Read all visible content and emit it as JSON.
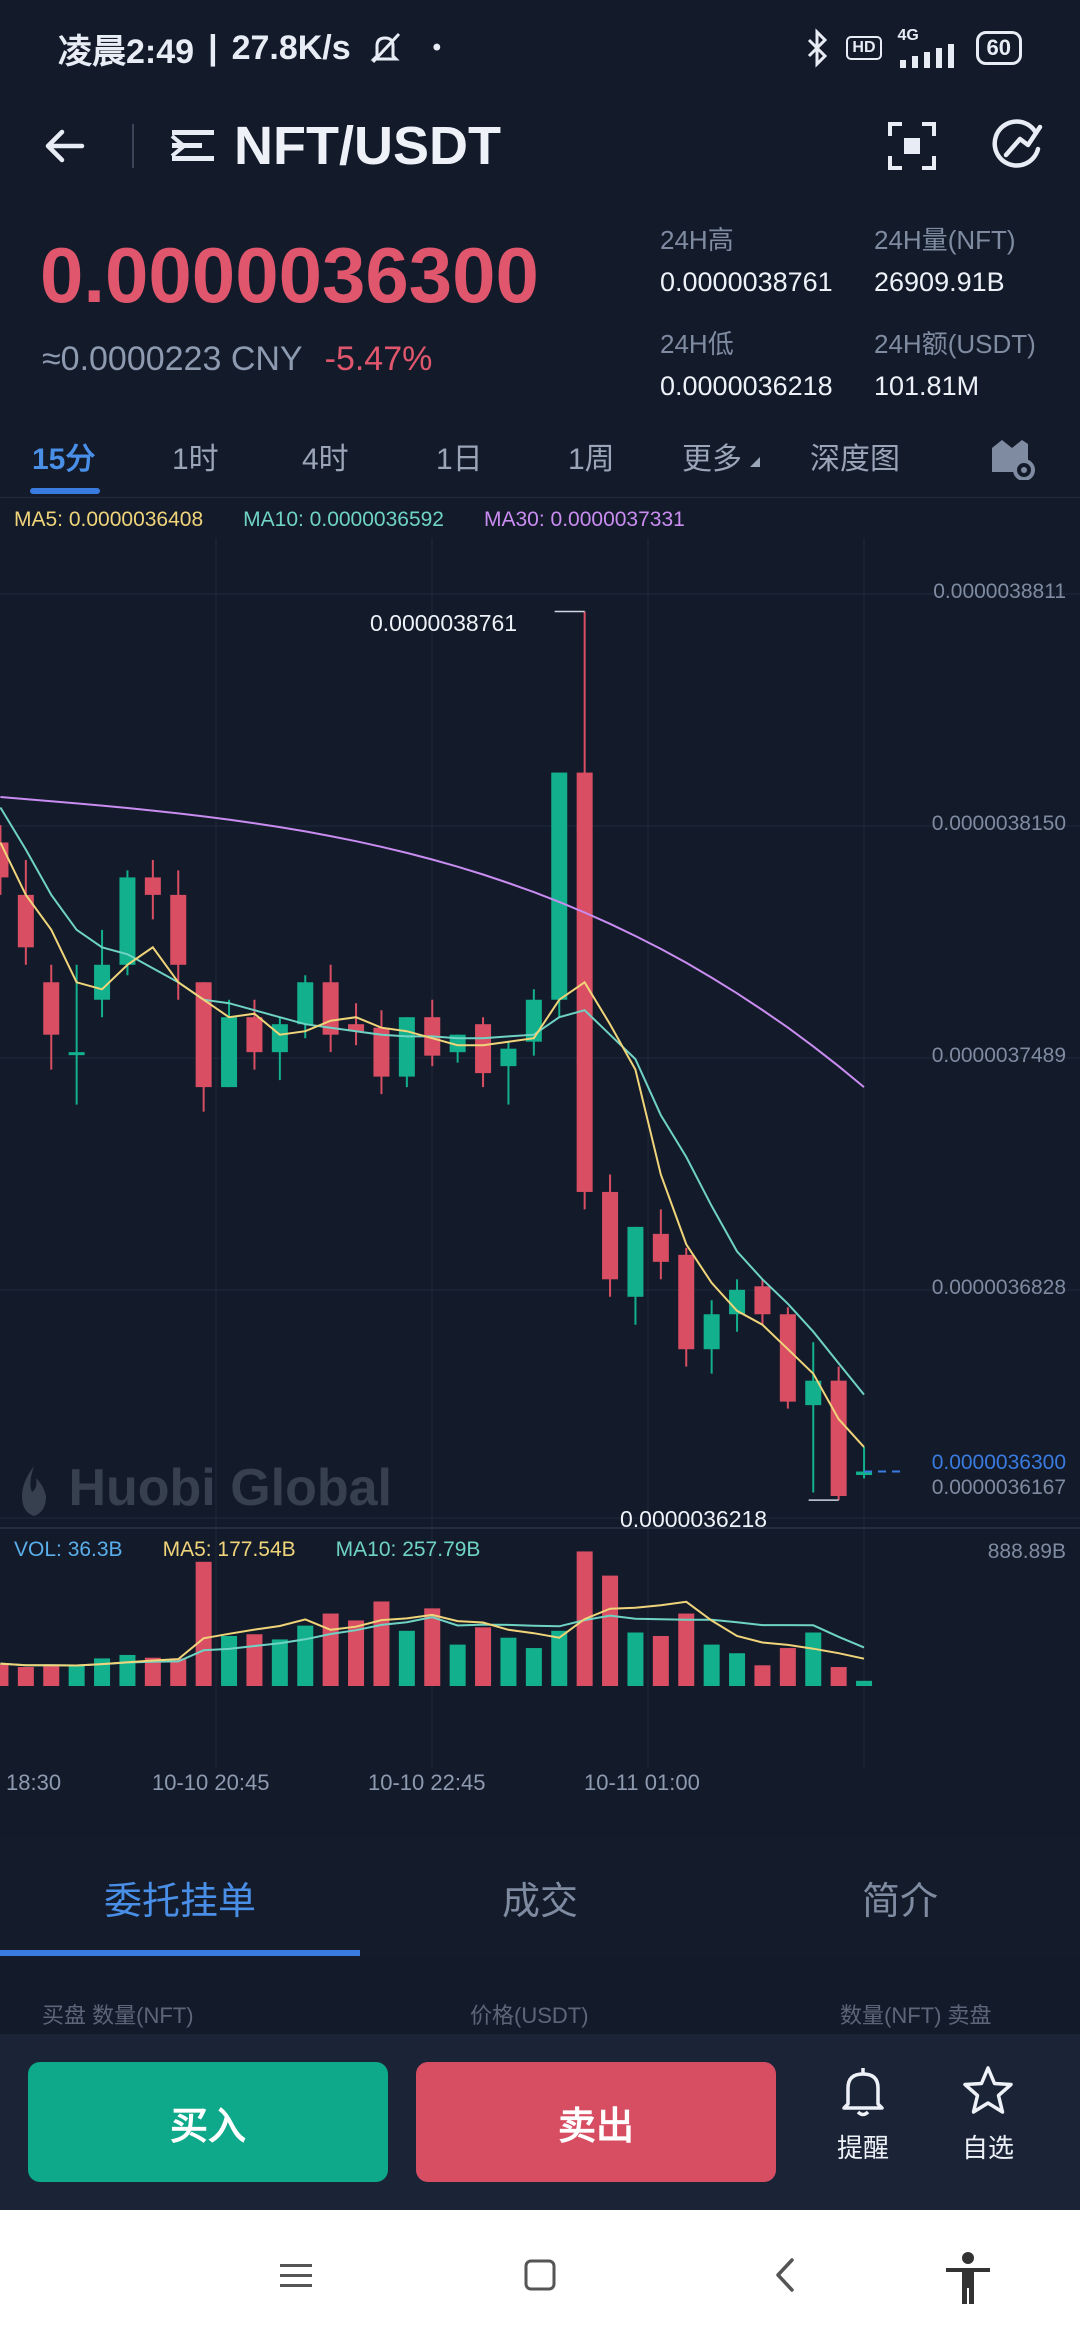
{
  "status_bar": {
    "time": "凌晨2:49",
    "speed": "27.8K/s",
    "dot": "•",
    "hd": "HD",
    "network": "4G",
    "battery": "60"
  },
  "header": {
    "pair": "NFT/USDT"
  },
  "ticker": {
    "price": "0.0000036300",
    "cny": "≈0.0000223 CNY",
    "change": "-5.47%",
    "high_label": "24H高",
    "high_value": "0.0000038761",
    "vol_label": "24H量(NFT)",
    "vol_value": "26909.91B",
    "low_label": "24H低",
    "low_value": "0.0000036218",
    "amount_label": "24H额(USDT)",
    "amount_value": "101.81M"
  },
  "timeframe_tabs": [
    {
      "label": "15分",
      "active": true
    },
    {
      "label": "1时"
    },
    {
      "label": "4时"
    },
    {
      "label": "1日"
    },
    {
      "label": "1周"
    },
    {
      "label": "更多"
    },
    {
      "label": "深度图"
    }
  ],
  "ma_legend": {
    "ma5": "MA5: 0.0000036408",
    "ma10": "MA10: 0.0000036592",
    "ma30": "MA30: 0.0000037331"
  },
  "vol_legend": {
    "vol": "VOL: 36.3B",
    "ma5": "MA5: 177.54B",
    "ma10": "MA10: 257.79B"
  },
  "watermark": "Huobi Global",
  "colors": {
    "up": "#12b08c",
    "down": "#d94e63",
    "ma5": "#f0d47a",
    "ma10": "#6fd3c4",
    "ma30": "#c98cf0",
    "accent": "#3a7be0"
  },
  "chart_data": {
    "type": "candlestick",
    "y_axis_ticks": [
      "0.0000038811",
      "0.0000038150",
      "0.0000037489",
      "0.0000036828",
      "0.0000036167"
    ],
    "y_range": [
      3.6167e-06,
      3.8811e-06
    ],
    "current_price_label": "0.0000036300",
    "high_marker": "0.0000038761",
    "low_marker": "0.0000036218",
    "volume_axis_max": "888.89B",
    "x_labels": [
      "18:30",
      "10-10 20:45",
      "10-10 22:45",
      "10-11 01:00"
    ],
    "candles": [
      {
        "o": 3.81,
        "h": 3.815,
        "c": 3.8,
        "l": 3.795
      },
      {
        "o": 3.795,
        "h": 3.805,
        "c": 3.78,
        "l": 3.775
      },
      {
        "o": 3.77,
        "h": 3.775,
        "c": 3.755,
        "l": 3.745
      },
      {
        "o": 3.75,
        "h": 3.775,
        "c": 3.75,
        "l": 3.735
      },
      {
        "o": 3.765,
        "h": 3.785,
        "c": 3.775,
        "l": 3.76
      },
      {
        "o": 3.775,
        "h": 3.802,
        "c": 3.8,
        "l": 3.772
      },
      {
        "o": 3.8,
        "h": 3.805,
        "c": 3.795,
        "l": 3.788
      },
      {
        "o": 3.795,
        "h": 3.802,
        "c": 3.775,
        "l": 3.765
      },
      {
        "o": 3.77,
        "h": 3.77,
        "c": 3.74,
        "l": 3.733
      },
      {
        "o": 3.74,
        "h": 3.765,
        "c": 3.76,
        "l": 3.74
      },
      {
        "o": 3.76,
        "h": 3.765,
        "c": 3.75,
        "l": 3.745
      },
      {
        "o": 3.75,
        "h": 3.76,
        "c": 3.758,
        "l": 3.742
      },
      {
        "o": 3.758,
        "h": 3.772,
        "c": 3.77,
        "l": 3.754
      },
      {
        "o": 3.77,
        "h": 3.775,
        "c": 3.755,
        "l": 3.75
      },
      {
        "o": 3.758,
        "h": 3.764,
        "c": 3.756,
        "l": 3.752
      },
      {
        "o": 3.757,
        "h": 3.762,
        "c": 3.743,
        "l": 3.738
      },
      {
        "o": 3.743,
        "h": 3.76,
        "c": 3.76,
        "l": 3.74
      },
      {
        "o": 3.76,
        "h": 3.765,
        "c": 3.749,
        "l": 3.746
      },
      {
        "o": 3.75,
        "h": 3.755,
        "c": 3.755,
        "l": 3.747
      },
      {
        "o": 3.758,
        "h": 3.76,
        "c": 3.744,
        "l": 3.74
      },
      {
        "o": 3.746,
        "h": 3.753,
        "c": 3.751,
        "l": 3.735
      },
      {
        "o": 3.753,
        "h": 3.768,
        "c": 3.765,
        "l": 3.749
      },
      {
        "o": 3.765,
        "h": 3.83,
        "c": 3.83,
        "l": 3.76
      },
      {
        "o": 3.83,
        "h": 3.8761,
        "c": 3.71,
        "l": 3.705
      },
      {
        "o": 3.71,
        "h": 3.715,
        "c": 3.685,
        "l": 3.68
      },
      {
        "o": 3.68,
        "h": 3.7,
        "c": 3.7,
        "l": 3.672
      },
      {
        "o": 3.698,
        "h": 3.705,
        "c": 3.69,
        "l": 3.685
      },
      {
        "o": 3.692,
        "h": 3.694,
        "c": 3.665,
        "l": 3.66
      },
      {
        "o": 3.665,
        "h": 3.679,
        "c": 3.675,
        "l": 3.658
      },
      {
        "o": 3.675,
        "h": 3.685,
        "c": 3.682,
        "l": 3.67
      },
      {
        "o": 3.683,
        "h": 3.685,
        "c": 3.675,
        "l": 3.672
      },
      {
        "o": 3.675,
        "h": 3.677,
        "c": 3.65,
        "l": 3.648
      },
      {
        "o": 3.649,
        "h": 3.667,
        "c": 3.656,
        "l": 3.624
      },
      {
        "o": 3.656,
        "h": 3.66,
        "c": 3.623,
        "l": 3.6218
      },
      {
        "o": 3.629,
        "h": 3.637,
        "c": 3.63,
        "l": 3.628
      }
    ],
    "volumes": [
      0.065,
      0.055,
      0.06,
      0.058,
      0.08,
      0.09,
      0.082,
      0.08,
      0.36,
      0.145,
      0.15,
      0.135,
      0.175,
      0.21,
      0.19,
      0.245,
      0.16,
      0.225,
      0.12,
      0.17,
      0.14,
      0.11,
      0.16,
      0.39,
      0.32,
      0.155,
      0.145,
      0.21,
      0.12,
      0.095,
      0.06,
      0.11,
      0.155,
      0.055,
      0.015
    ],
    "ma5": [
      3.81,
      3.795,
      3.785,
      3.77,
      3.768,
      3.775,
      3.78,
      3.77,
      3.765,
      3.76,
      3.761,
      3.755,
      3.756,
      3.759,
      3.76,
      3.757,
      3.756,
      3.754,
      3.752,
      3.752,
      3.753,
      3.754,
      3.765,
      3.77,
      3.758,
      3.745,
      3.715,
      3.695,
      3.684,
      3.676,
      3.672,
      3.665,
      3.658,
      3.645,
      3.637
    ],
    "ma10": [
      3.82,
      3.808,
      3.795,
      3.785,
      3.78,
      3.778,
      3.774,
      3.77,
      3.765,
      3.764,
      3.762,
      3.76,
      3.758,
      3.757,
      3.756,
      3.755,
      3.7545,
      3.7545,
      3.754,
      3.754,
      3.7545,
      3.755,
      3.76,
      3.762,
      3.755,
      3.748,
      3.732,
      3.72,
      3.706,
      3.693,
      3.685,
      3.678,
      3.67,
      3.661,
      3.652
    ]
  },
  "section_tabs": [
    {
      "label": "委托挂单",
      "active": true
    },
    {
      "label": "成交"
    },
    {
      "label": "简介"
    }
  ],
  "subheaders": {
    "left": "买盘 数量(NFT)",
    "middle": "价格(USDT)",
    "right": "数量(NFT) 卖盘"
  },
  "actions": {
    "buy": "买入",
    "sell": "卖出",
    "alert": "提醒",
    "favorite": "自选"
  }
}
